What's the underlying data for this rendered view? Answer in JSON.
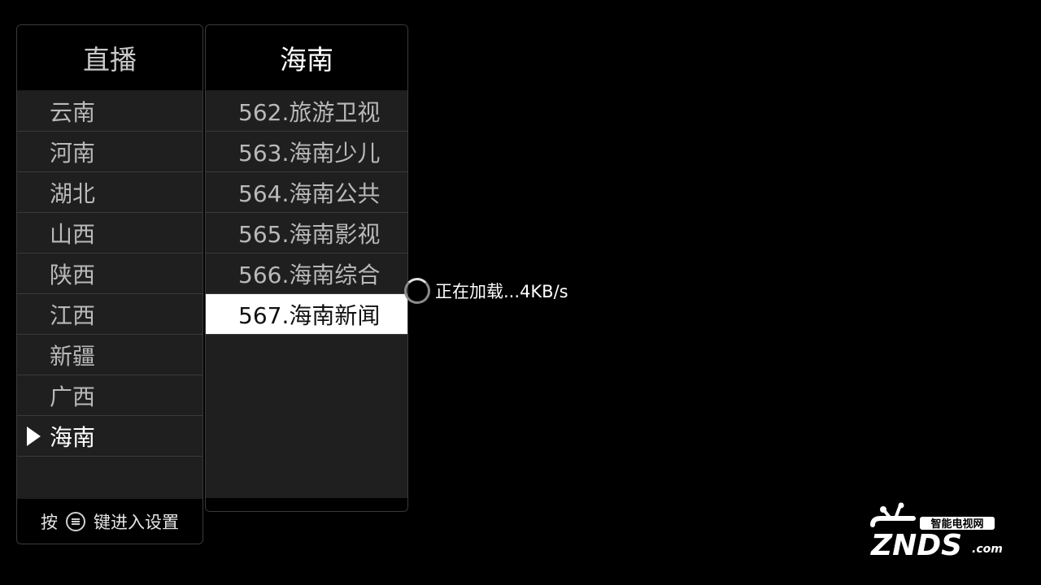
{
  "left_panel": {
    "title": "直播",
    "categories": [
      {
        "label": "云南"
      },
      {
        "label": "河南"
      },
      {
        "label": "湖北"
      },
      {
        "label": "山西"
      },
      {
        "label": "陕西"
      },
      {
        "label": "江西"
      },
      {
        "label": "新疆"
      },
      {
        "label": "广西"
      },
      {
        "label": "海南"
      }
    ],
    "selected_index": 8,
    "footer": {
      "prefix": "按",
      "icon": "menu-key-icon",
      "suffix": "键进入设置"
    }
  },
  "right_panel": {
    "title": "海南",
    "channels": [
      {
        "label": "562.旅游卫视"
      },
      {
        "label": "563.海南少儿"
      },
      {
        "label": "564.海南公共"
      },
      {
        "label": "565.海南影视"
      },
      {
        "label": "566.海南综合"
      },
      {
        "label": "567.海南新闻"
      }
    ],
    "active_index": 5
  },
  "loading": {
    "text": "正在加载...4KB/s",
    "icon": "spinner-icon"
  },
  "watermark": {
    "top_text": "智能电视网",
    "brand": "ZNDS",
    "suffix": ".com"
  },
  "colors": {
    "background": "#000000",
    "panel": "#1f1f1f",
    "active_row": "#ffffff"
  }
}
